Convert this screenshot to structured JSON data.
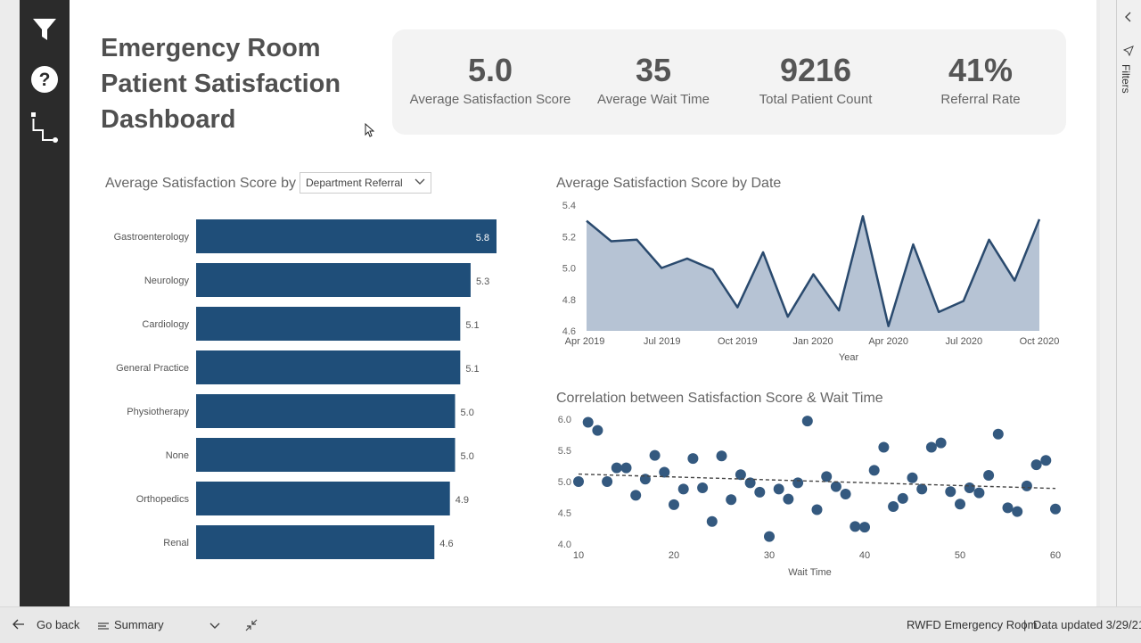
{
  "report": {
    "title_lines": [
      "Emergency Room",
      "Patient Satisfaction",
      "Dashboard"
    ]
  },
  "kpis": [
    {
      "value": "5.0",
      "label": "Average Satisfaction Score"
    },
    {
      "value": "35",
      "label": "Average Wait Time"
    },
    {
      "value": "9216",
      "label": "Total Patient Count"
    },
    {
      "value": "41%",
      "label": "Referral Rate"
    }
  ],
  "bar_visual": {
    "title_prefix": "Average Satisfaction Score by",
    "dropdown_value": "Department Referral"
  },
  "line_visual": {
    "title": "Average Satisfaction Score by Date"
  },
  "scatter_visual": {
    "title": "Correlation between Satisfaction Score & Wait Time"
  },
  "side_pane": {
    "filters_label": "Filters"
  },
  "bottom_bar": {
    "go_back": "Go back",
    "page_name": "Summary",
    "report_name": "RWFD Emergency Room",
    "separator": "|",
    "data_updated": "Data updated 3/29/21"
  },
  "icons": {
    "filter": "filter-icon",
    "help": "help-icon",
    "navigation": "navigation-icon",
    "collapse": "chevron-left-icon",
    "send": "send-icon",
    "back": "arrow-left-icon",
    "page_list": "list-icon",
    "dropdown": "chevron-down-icon",
    "shrink": "collapse-icon"
  },
  "colors": {
    "bar": "#1f4e79",
    "area_fill": "#a9b8cc",
    "line": "#2a4a6e",
    "point": "#34597f",
    "sidebar": "#2b2b2b"
  },
  "chart_data": [
    {
      "type": "bar",
      "orientation": "horizontal",
      "categories": [
        "Gastroenterology",
        "Neurology",
        "Cardiology",
        "General Practice",
        "Physiotherapy",
        "None",
        "Orthopedics",
        "Renal"
      ],
      "values": [
        5.8,
        5.3,
        5.1,
        5.1,
        5.0,
        5.0,
        4.9,
        4.6
      ],
      "data_labels": [
        "5.8",
        "5.3",
        "5.1",
        "5.1",
        "5.0",
        "5.0",
        "4.9",
        "4.6"
      ],
      "xlim": [
        0,
        5.8
      ]
    },
    {
      "type": "area",
      "x": [
        "2019-04-01",
        "2019-05-01",
        "2019-06-01",
        "2019-07-01",
        "2019-08-01",
        "2019-09-01",
        "2019-10-01",
        "2019-11-01",
        "2019-12-01",
        "2020-01-01",
        "2020-02-01",
        "2020-03-01",
        "2020-04-01",
        "2020-05-01",
        "2020-06-01",
        "2020-07-01",
        "2020-08-01",
        "2020-09-01",
        "2020-10-01"
      ],
      "values": [
        5.3,
        5.17,
        5.18,
        5.0,
        5.06,
        4.99,
        4.75,
        5.1,
        4.69,
        4.96,
        4.73,
        5.33,
        4.63,
        5.15,
        4.72,
        4.79,
        5.18,
        4.92,
        5.31
      ],
      "xtick_labels": [
        "Apr 2019",
        "Jul 2019",
        "Oct 2019",
        "Jan 2020",
        "Apr 2020",
        "Jul 2020",
        "Oct 2020"
      ],
      "ytick_labels": [
        "5.4",
        "5.2",
        "5.0",
        "4.8",
        "4.6"
      ],
      "ylim": [
        4.6,
        5.4
      ],
      "xlabel": "Year"
    },
    {
      "type": "scatter",
      "x": [
        10,
        11,
        12,
        13,
        14,
        15,
        16,
        17,
        18,
        19,
        20,
        21,
        22,
        23,
        24,
        25,
        26,
        27,
        28,
        29,
        30,
        31,
        32,
        33,
        34,
        35,
        36,
        37,
        38,
        39,
        40,
        41,
        42,
        43,
        44,
        45,
        46,
        47,
        48,
        49,
        50,
        51,
        52,
        53,
        54,
        55,
        56,
        57,
        58,
        59,
        60
      ],
      "y": [
        5.0,
        5.95,
        5.82,
        5.0,
        5.22,
        5.22,
        4.78,
        5.04,
        5.42,
        5.15,
        4.63,
        4.88,
        5.37,
        4.9,
        4.36,
        5.41,
        4.71,
        5.11,
        4.98,
        4.83,
        4.12,
        4.88,
        4.72,
        4.98,
        5.97,
        4.55,
        5.08,
        4.92,
        4.8,
        4.28,
        4.27,
        5.18,
        5.55,
        4.6,
        4.73,
        5.06,
        4.88,
        5.55,
        5.62,
        4.84,
        4.64,
        4.9,
        4.82,
        5.1,
        5.76,
        4.58,
        4.52,
        4.93,
        5.27,
        5.34,
        4.56
      ],
      "trend": {
        "x": [
          10,
          60
        ],
        "y": [
          5.12,
          4.89
        ]
      },
      "xtick_labels": [
        "10",
        "20",
        "30",
        "40",
        "50",
        "60"
      ],
      "ytick_labels": [
        "6.0",
        "5.5",
        "5.0",
        "4.5",
        "4.0"
      ],
      "xlim": [
        10,
        60
      ],
      "ylim": [
        4.0,
        6.0
      ],
      "xlabel": "Wait Time"
    }
  ]
}
